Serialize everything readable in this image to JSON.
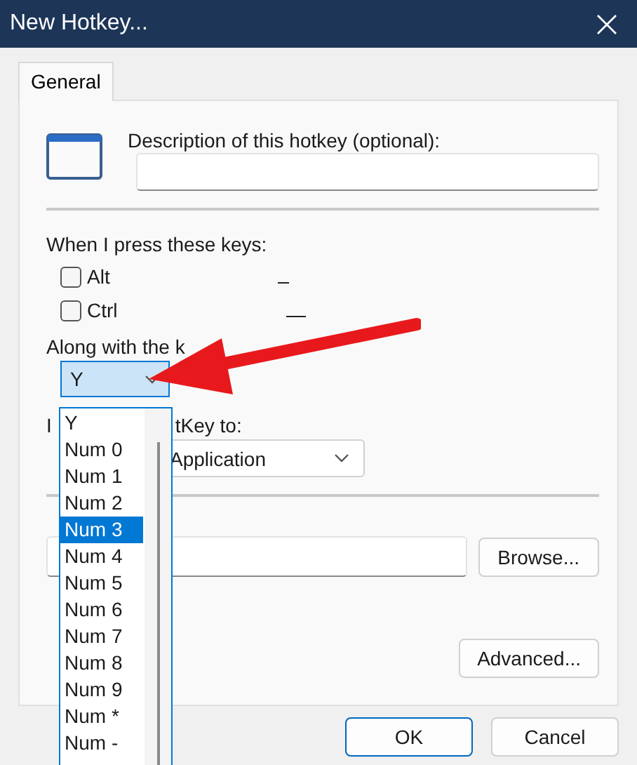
{
  "window": {
    "title": "New Hotkey..."
  },
  "tabs": [
    {
      "label": "General",
      "selected": true
    }
  ],
  "description": {
    "label": "Description of this hotkey (optional):"
  },
  "keys_label": "When I press these keys:",
  "modifiers": [
    {
      "label": "Alt",
      "checked": false
    },
    {
      "label": "Ctrl",
      "checked": false
    }
  ],
  "key_label": "Along with the k",
  "key_combo": {
    "value": "Y",
    "open": true
  },
  "key_options": [
    {
      "label": "Y",
      "selected": false
    },
    {
      "label": "Num 0",
      "selected": false
    },
    {
      "label": "Num 1",
      "selected": false
    },
    {
      "label": "Num 2",
      "selected": false
    },
    {
      "label": "Num 3",
      "selected": true
    },
    {
      "label": "Num 4",
      "selected": false
    },
    {
      "label": "Num 5",
      "selected": false
    },
    {
      "label": "Num 6",
      "selected": false
    },
    {
      "label": "Num 7",
      "selected": false
    },
    {
      "label": "Num 8",
      "selected": false
    },
    {
      "label": "Num 9",
      "selected": false
    },
    {
      "label": "Num *",
      "selected": false
    },
    {
      "label": "Num -",
      "selected": false
    }
  ],
  "action_label_parts": [
    "I",
    "tKey to:"
  ],
  "action_combo": {
    "value": "Application"
  },
  "browse_button": {
    "label": "Browse..."
  },
  "advanced_button": {
    "label": "Advanced..."
  },
  "buttons": [
    {
      "label": "OK",
      "default": true
    },
    {
      "label": "Cancel",
      "default": false
    }
  ]
}
